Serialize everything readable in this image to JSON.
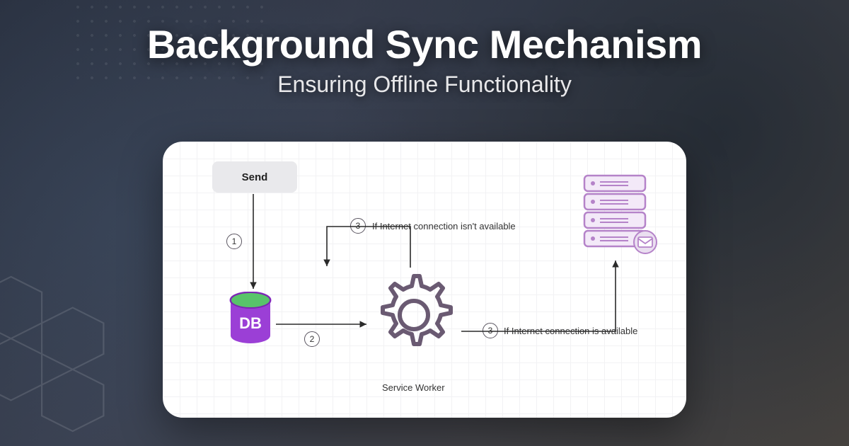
{
  "header": {
    "title": "Background Sync Mechanism",
    "subtitle": "Ensuring Offline Functionality"
  },
  "diagram": {
    "send_label": "Send",
    "db_label": "DB",
    "service_worker_label": "Service Worker",
    "steps": {
      "s1": "1",
      "s2": "2",
      "s3a": "3",
      "s3b": "3"
    },
    "captions": {
      "offline": "If Internet connection isn't available",
      "online": "If Internet connection is available"
    },
    "icons": {
      "send": "send-button",
      "db": "database-icon",
      "gear": "gear-icon",
      "server": "server-icon",
      "mail": "mail-icon"
    }
  },
  "colors": {
    "db_purple": "#9b3fd6",
    "db_green": "#58c46a",
    "outline": "#6a5a72",
    "server_purple": "#b583c9",
    "server_fill": "#f3e9f8"
  }
}
